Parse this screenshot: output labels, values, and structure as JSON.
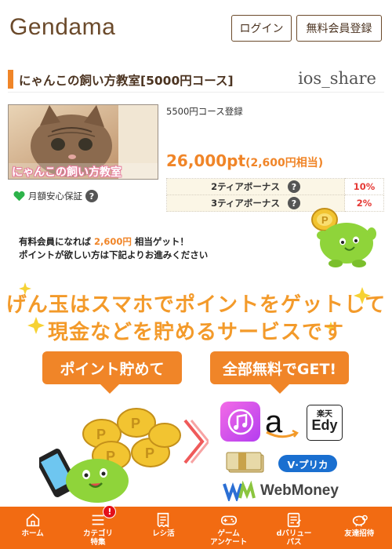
{
  "header": {
    "logo_text": "Gendama",
    "login_label": "ログイン",
    "register_label": "無料会員登録"
  },
  "title": {
    "text": "にゃんこの飼い方教室[5000円コース]",
    "share_text": "ios_share"
  },
  "offer": {
    "thumbnail_caption": "にゃんこの飼い方教室",
    "course_text": "5500円コース登録",
    "points_main": "26,000pt",
    "points_yen": "(2,600円相当)",
    "guarantee_text": "月額安心保証",
    "help_icon_text": "?",
    "bonus_rows": [
      {
        "label": "2ティアボーナス",
        "percent": "10%"
      },
      {
        "label": "3ティアボーナス",
        "percent": "2%"
      }
    ]
  },
  "promo": {
    "line1_prefix": "有料会員になれば ",
    "line1_amount": "2,600円",
    "line1_suffix": " 相当ゲット！",
    "line2": "ポイントが欲しい方は下記よりお進みください"
  },
  "banner": {
    "headline_1": "げん玉はスマホでポイントをゲットして",
    "headline_2": "現金などを貯めるサービスです",
    "left_pill": "ポイント貯めて",
    "right_pill": "全部無料でGET!",
    "coin_letter": "P",
    "services": {
      "amazon_glyph": "a",
      "rakuten_edy_top": "楽天",
      "rakuten_edy_bottom": "Edy",
      "vpreca": "V·プリカ",
      "webmoney": "WebMoney"
    }
  },
  "bottom_nav": {
    "items": [
      {
        "label": "ホーム",
        "icon": "home-icon"
      },
      {
        "label": "カテゴリ\n特集",
        "icon": "menu-icon",
        "badge": "!"
      },
      {
        "label": "レシ活",
        "icon": "receipt-icon"
      },
      {
        "label": "ゲーム\nアンケート",
        "icon": "gamepad-icon"
      },
      {
        "label": "dバリュー\nパス",
        "icon": "clipboard-icon"
      },
      {
        "label": "友達招待",
        "icon": "piggy-icon"
      }
    ]
  },
  "colors": {
    "brand_orange": "#f08528",
    "nav_orange": "#f26b12",
    "logo_brown": "#6b4a2b",
    "bonus_red": "#e53935"
  }
}
